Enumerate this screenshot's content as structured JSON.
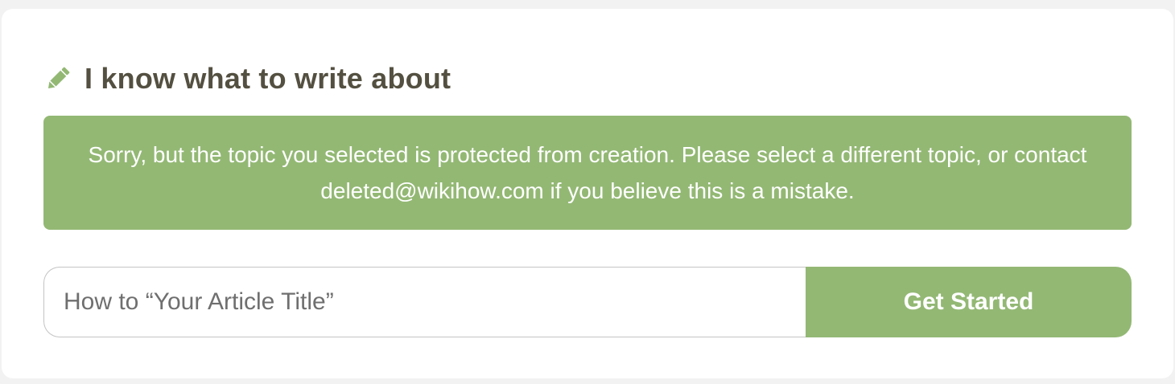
{
  "section": {
    "title": "I know what to write about",
    "icon": "pencil-icon",
    "accent_color": "#93b874"
  },
  "alert": {
    "message": "Sorry, but the topic you selected is protected from creation. Please select a different topic, or contact deleted@wikihow.com if you believe this is a mistake."
  },
  "form": {
    "title_placeholder": "How to “Your Article Title”",
    "title_value": "",
    "submit_label": "Get Started"
  }
}
